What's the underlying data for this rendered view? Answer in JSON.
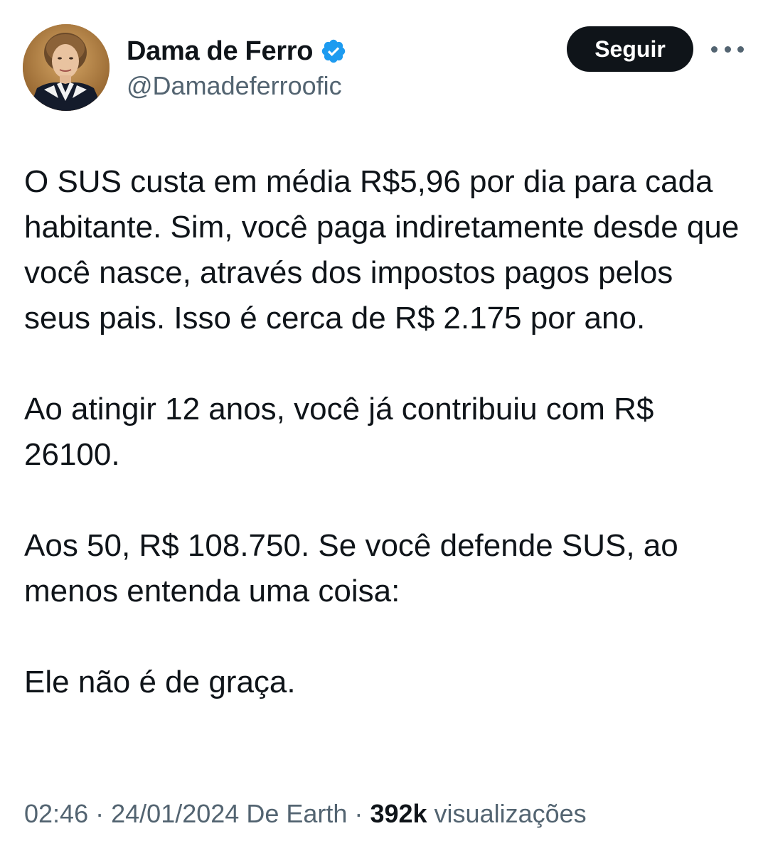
{
  "author": {
    "display_name": "Dama de Ferro",
    "handle": "@Damadeferroofic",
    "verified": true,
    "verified_color": "#1d9bf0"
  },
  "actions": {
    "follow_label": "Seguir",
    "more_icon": "more-horizontal-icon"
  },
  "tweet": {
    "paragraphs": [
      "O SUS custa em média R$5,96 por dia para cada habitante. Sim, você paga indiretamente desde que você nasce, através dos impostos pagos pelos seus pais. Isso é cerca de R$ 2.175 por ano.",
      "Ao atingir 12 anos, você já contribuiu com R$ 26100.",
      "Aos 50, R$ 108.750.  Se você defende SUS, ao menos entenda uma coisa:",
      "Ele não é de graça."
    ]
  },
  "meta": {
    "time": "02:46",
    "date": "24/01/2024",
    "source": "De Earth",
    "separator": "·",
    "views_count": "392k",
    "views_label": "visualizações"
  },
  "colors": {
    "text_primary": "#0f1419",
    "text_secondary": "#536471",
    "button_bg": "#0f1419",
    "button_text": "#ffffff"
  }
}
